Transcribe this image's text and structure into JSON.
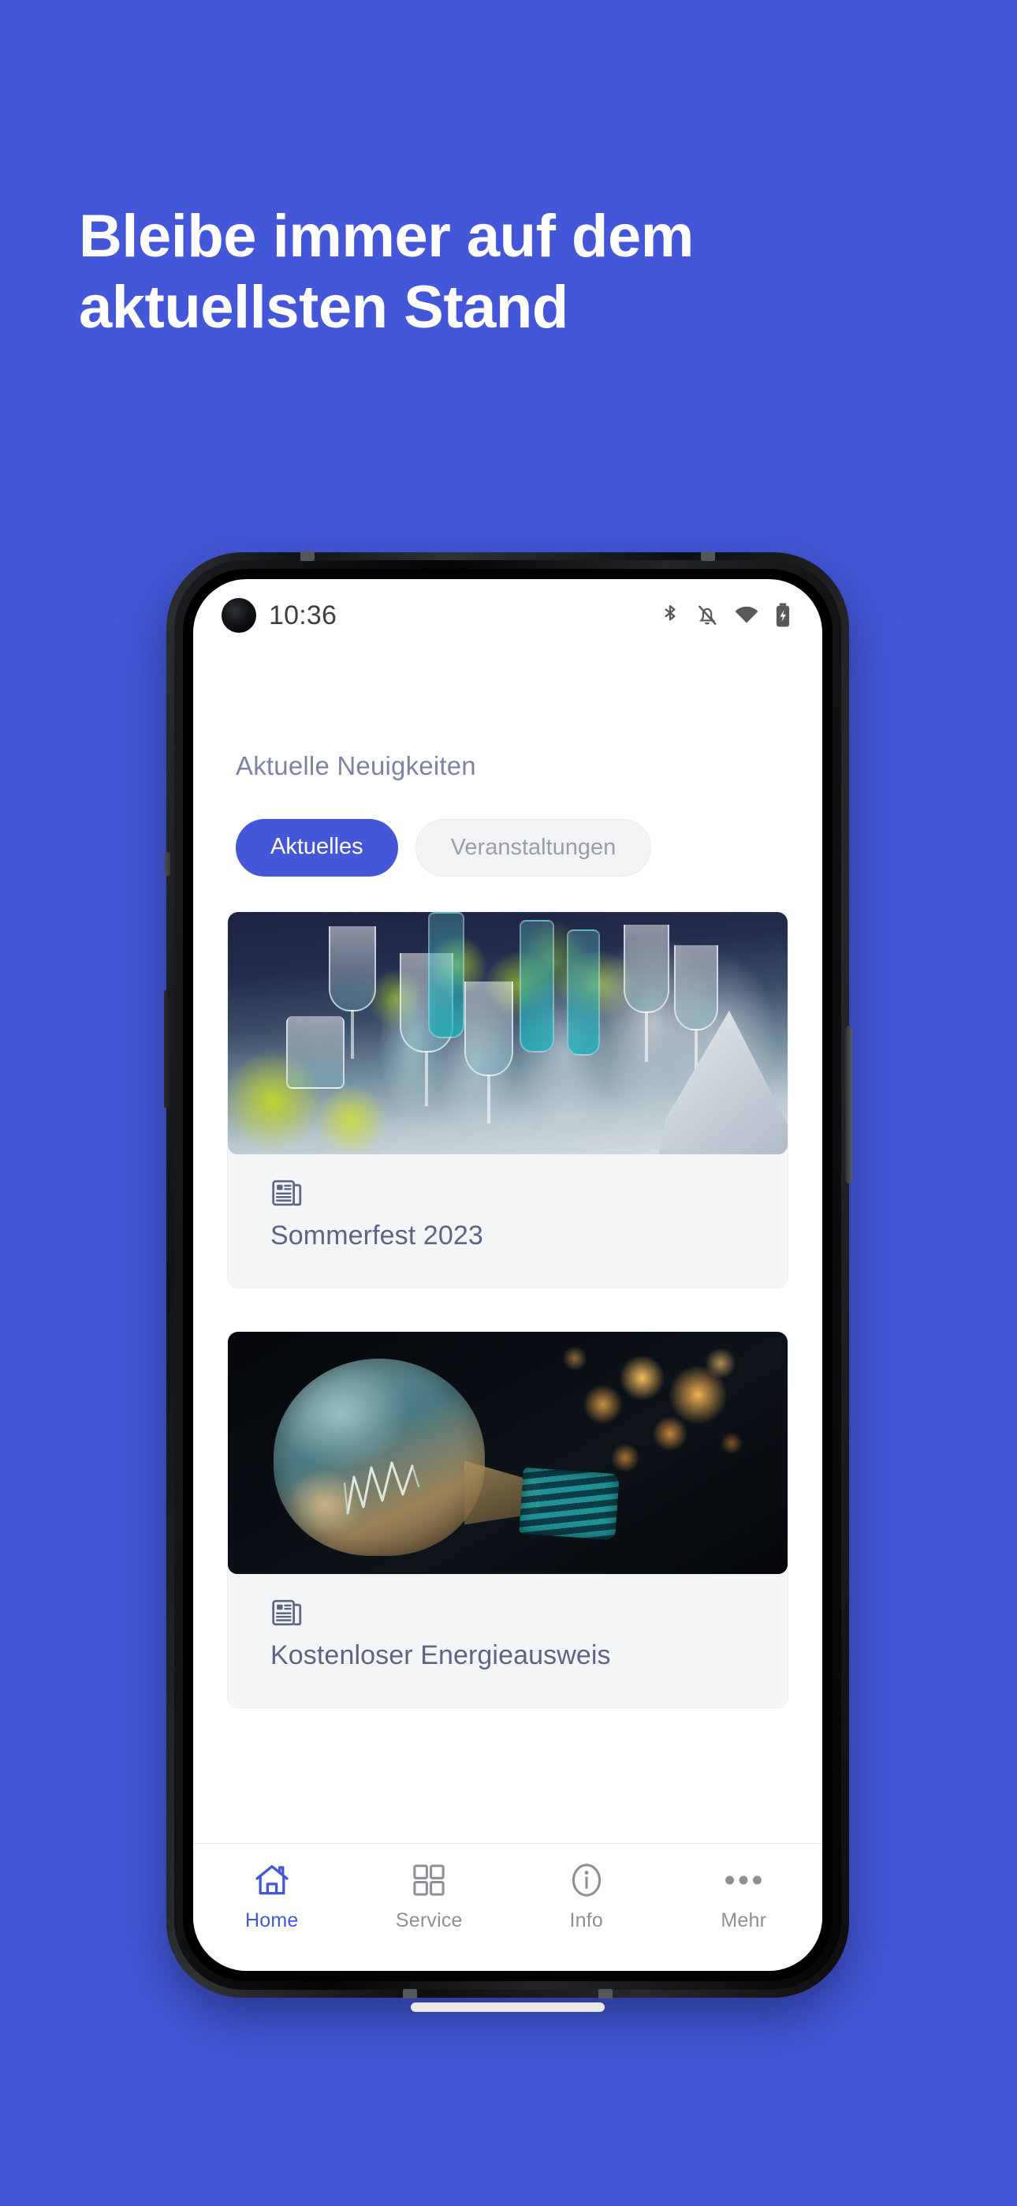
{
  "colors": {
    "background_blue": "#4457D8",
    "accent_blue": "#4457D8",
    "muted_text": "#7c84a3",
    "card_bg": "#f4f5f7",
    "nav_inactive": "#8d9098"
  },
  "headline": {
    "line1": "Bleibe immer auf dem",
    "line2": "aktuellsten Stand"
  },
  "phone": {
    "status_bar": {
      "time": "10:36",
      "icons": [
        {
          "name": "bluetooth-icon"
        },
        {
          "name": "notifications-off-icon"
        },
        {
          "name": "wifi-icon"
        },
        {
          "name": "battery-charging-icon"
        }
      ]
    },
    "screen": {
      "section_title": "Aktuelle Neuigkeiten",
      "tabs": [
        {
          "label": "Aktuelles",
          "active": true
        },
        {
          "label": "Veranstaltungen",
          "active": false
        }
      ],
      "cards": [
        {
          "title": "Sommerfest 2023",
          "icon": "newspaper-icon",
          "image_alt": "Festlich gedeckter Tisch mit Sektgläsern und grün-gelber Blumendekoration"
        },
        {
          "title": "Kostenloser Energieausweis",
          "icon": "newspaper-icon",
          "image_alt": "Glühbirne mit sichtbarem Glühfaden vor orangefarbenen Bokeh-Lichtern"
        }
      ],
      "bottom_nav": [
        {
          "label": "Home",
          "icon": "home-icon",
          "active": true
        },
        {
          "label": "Service",
          "icon": "grid-icon",
          "active": false
        },
        {
          "label": "Info",
          "icon": "info-circle-icon",
          "active": false
        },
        {
          "label": "Mehr",
          "icon": "ellipsis-icon",
          "active": false
        }
      ]
    }
  }
}
